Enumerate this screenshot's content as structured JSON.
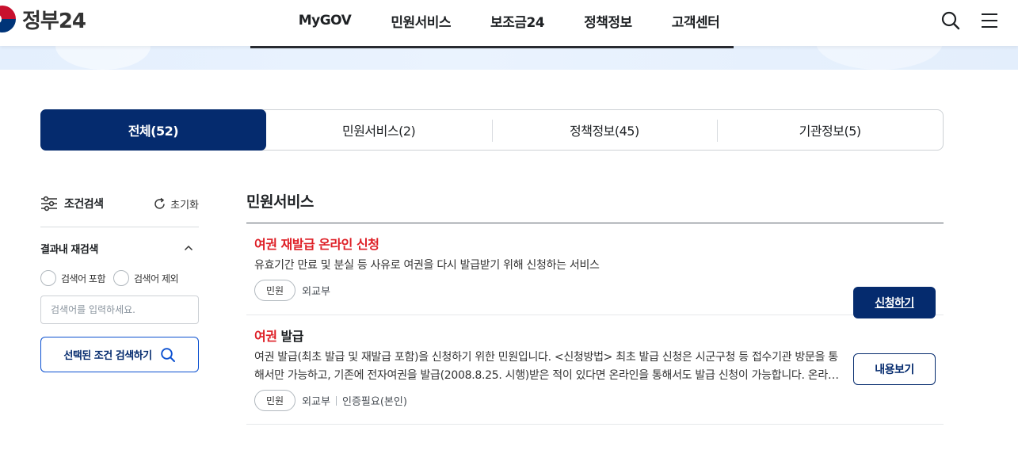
{
  "header": {
    "logo_text": "정부24",
    "nav": [
      "MyGOV",
      "민원서비스",
      "보조금24",
      "정책정보",
      "고객센터"
    ],
    "search_icon": "search-icon",
    "menu_icon": "hamburger-menu-icon"
  },
  "tabs": [
    {
      "label": "전체(52)",
      "active": true
    },
    {
      "label": "민원서비스(2)",
      "active": false
    },
    {
      "label": "정책정보(45)",
      "active": false
    },
    {
      "label": "기관정보(5)",
      "active": false
    }
  ],
  "sidebar": {
    "title": "조건검색",
    "reset_label": "초기화",
    "section_title": "결과내 재검색",
    "radio_include": "검색어 포함",
    "radio_exclude": "검색어 제외",
    "input_placeholder": "검색어를 입력하세요.",
    "search_button": "선택된 조건 검색하기"
  },
  "results": {
    "section_title": "민원서비스",
    "items": [
      {
        "title_hl": "여권 재발급 온라인 신청",
        "title_rest": "",
        "desc": "유효기간 만료 및 분실 등 사유로 여권을 다시 발급받기 위해 신청하는 서비스",
        "chip": "민원",
        "org": "외교부",
        "extra": "",
        "button": "신청하기"
      },
      {
        "title_hl": "여권",
        "title_rest": " 발급",
        "desc": "여권 발급(최초 발급 및 재발급 포함)을 신청하기 위한 민원입니다. <신청방법> 최초 발급 신청은 시군구청 등 접수기관 방문을 통해서만 가능하고, 기존에 전자여권을 발급(2008.8.25. 시행)받은 적이 있다면 온라인을 통해서도 발급 신청이 가능합니다. 온라인 신청 시 본인인증이 필요합니다.",
        "chip": "민원",
        "org": "외교부",
        "extra": "인증필요(본인)",
        "button": "내용보기"
      }
    ]
  },
  "colors": {
    "primary": "#052b6e",
    "highlight": "#de1f26",
    "outline_blue": "#0b50d0"
  }
}
